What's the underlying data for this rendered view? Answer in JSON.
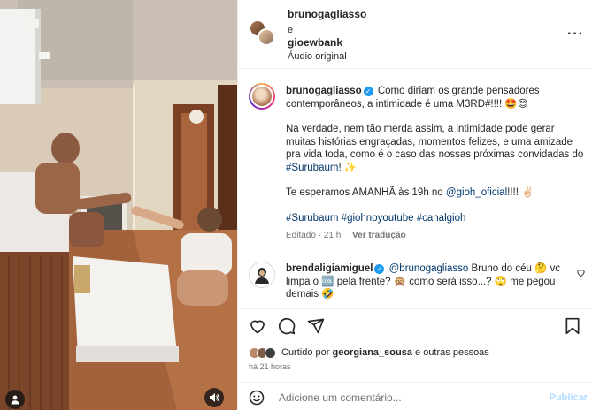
{
  "header": {
    "user1": "brunogagliasso",
    "connector": "e",
    "user2": "gioewbank",
    "audio": "Áudio original",
    "more_icon": "more-options-icon"
  },
  "caption": {
    "username": "brunogagliasso",
    "line1": "Como diriam os grande pensadores contemporâneos, a intimidade é uma M3RD#!!!! 🤩😊",
    "para2_a": "Na verdade, nem tão merda assim, a intimidade pode gerar muitas histórias engraçadas, momentos felizes, e uma amizade pra vida toda, como é o caso das nossas próximas convidadas do ",
    "hashtag_surubaum": "#Surubaum",
    "para2_b": "! ✨",
    "para3_a": "Te esperamos AMANHÃ às 19h no ",
    "mention_gioh": "@gioh_oficial",
    "para3_b": "!!!! ✌🏻",
    "hashtags": [
      "#Surubaum",
      "#giohnoyoutube",
      "#canalgioh"
    ],
    "edited": "Editado · 21 h",
    "translate": "Ver tradução"
  },
  "comment": {
    "username": "brendaligiamiguel",
    "mention": "@brunogagliasso",
    "text": " Bruno do céu 🤔 vc limpa o 🆒 pela frente? 🙊 como será isso...? 🙄 me pegou demais 🤣"
  },
  "likes": {
    "prefix": "Curtido por ",
    "user": "georgiana_sousa",
    "suffix": " e outras pessoas"
  },
  "timestamp": "há 21 horas",
  "add_comment": {
    "placeholder": "Adicione um comentário...",
    "publish": "Publicar"
  },
  "colors": {
    "link": "#00376b",
    "verified": "#1d9bf0",
    "publish_disabled": "#b3dbff"
  }
}
